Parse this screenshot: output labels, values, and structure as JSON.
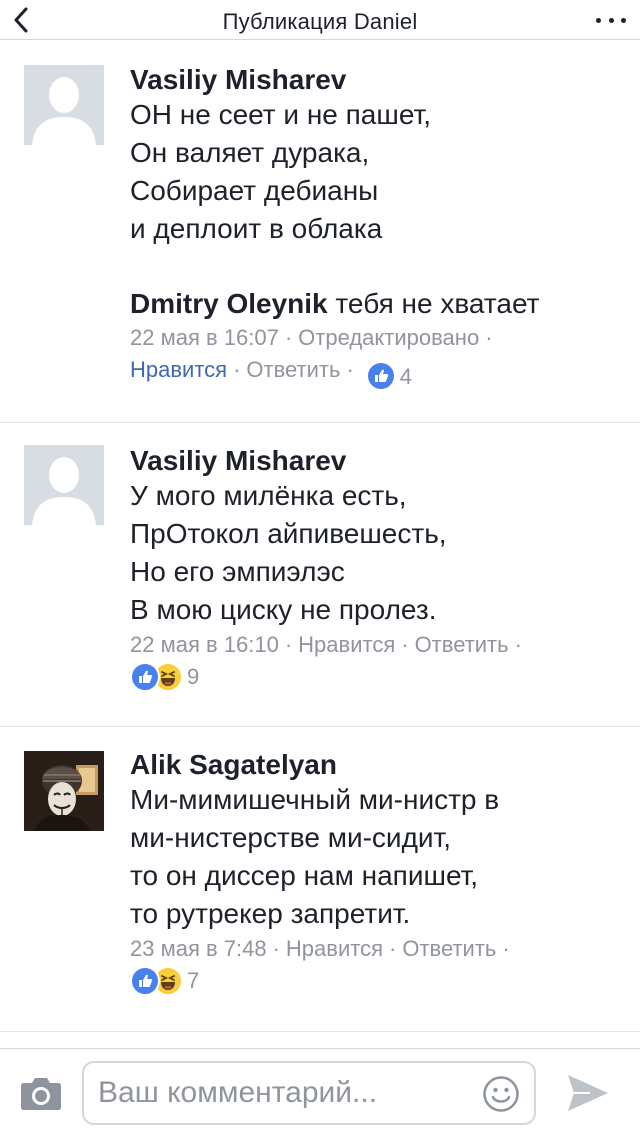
{
  "nav": {
    "title": "Публикация Daniel"
  },
  "comments": [
    {
      "author": "Vasiliy Misharev",
      "lines": [
        "ОН не сеет и не пашет,",
        "Он валяет дурака,",
        "Собирает дебианы",
        "и деплоит в облака"
      ],
      "reply": {
        "author": "Dmitry Oleynik",
        "text": " тебя не хватает",
        "time": "22 мая в 16:07",
        "edited": "Отредактировано",
        "like": "Нравится",
        "answer": "Ответить",
        "count": "4"
      }
    },
    {
      "author": "Vasiliy Misharev",
      "lines": [
        "У мого милёнка есть,",
        "ПрОтокол айпивешесть,",
        "Но его эмпиэлэс",
        "В мою циску не пролез."
      ],
      "time": "22 мая в 16:10",
      "like": "Нравится",
      "answer": "Ответить",
      "count": "9"
    },
    {
      "author": "Alik Sagatelyan",
      "lines": [
        "Ми-мимишечный ми-нистр в",
        "ми-нистерстве ми-сидит,",
        "то он диссер нам напишет,",
        "то рутрекер запретит."
      ],
      "time": "23 мая в 7:48",
      "like": "Нравится",
      "answer": "Ответить",
      "count": "7"
    }
  ],
  "composer": {
    "placeholder": "Ваш комментарий..."
  },
  "colors": {
    "link": "#4267b2",
    "meta": "#90949c",
    "like_reaction": "#4a80ee",
    "haha_reaction": "#f7cf3e"
  }
}
